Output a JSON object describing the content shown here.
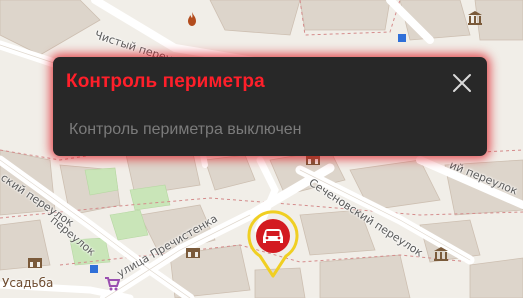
{
  "notification": {
    "title": "Контроль периметра",
    "message": "Контроль периметра выключен",
    "close_icon": "close-icon",
    "colors": {
      "title": "#ff1f2a",
      "background": "#282828",
      "glow": "#dc141e",
      "text": "#7b7b7b"
    }
  },
  "map": {
    "streets": {
      "chisty": "Чистый переулок",
      "ostozhenka_left": "ский переулок",
      "prechistensky": "переулок",
      "prechistenka": "улица Пречистенка",
      "sechenovsky": "Сеченовский переулок",
      "right_lane": "ий переулок"
    },
    "places": {
      "usadba": "Усадьба"
    },
    "icons": [
      "fire-icon",
      "museum-icon",
      "theatre-icon",
      "shop-icon",
      "bus-stop-icon"
    ]
  },
  "vehicle_marker": {
    "icon": "car-icon",
    "colors": {
      "fill": "#d31a21",
      "ring": "#f0cf22"
    }
  }
}
